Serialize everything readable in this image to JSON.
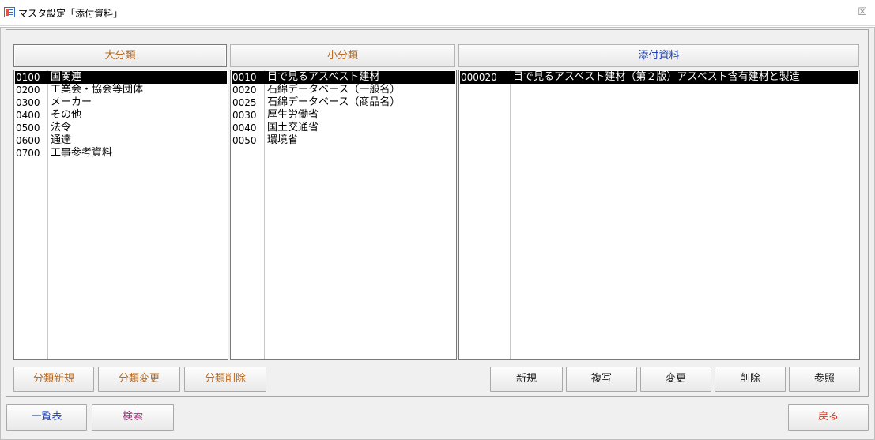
{
  "window": {
    "title": "マスタ設定「添付資料」",
    "close_glyph": "☒"
  },
  "headers": {
    "major": "大分類",
    "minor": "小分類",
    "attachment": "添付資料"
  },
  "major_list": [
    {
      "code": "0100",
      "name": "国関連",
      "selected": true
    },
    {
      "code": "0200",
      "name": "工業会・協会等団体"
    },
    {
      "code": "0300",
      "name": "メーカー"
    },
    {
      "code": "0400",
      "name": "その他"
    },
    {
      "code": "0500",
      "name": "法令"
    },
    {
      "code": "0600",
      "name": "通達"
    },
    {
      "code": "0700",
      "name": "工事参考資料"
    }
  ],
  "minor_list": [
    {
      "code": "0010",
      "name": "目で見るアスベスト建材",
      "selected": true
    },
    {
      "code": "0020",
      "name": "石綿データベース（一般名）"
    },
    {
      "code": "0025",
      "name": "石綿データベース（商品名）"
    },
    {
      "code": "0030",
      "name": "厚生労働省"
    },
    {
      "code": "0040",
      "name": "国土交通省"
    },
    {
      "code": "0050",
      "name": "環境省"
    }
  ],
  "attachment_list": [
    {
      "code": "000020",
      "name": "目で見るアスベスト建材（第２版）アスベスト含有建材と製造",
      "selected": true
    }
  ],
  "category_buttons": {
    "new": "分類新規",
    "edit": "分類変更",
    "delete": "分類削除"
  },
  "attachment_buttons": {
    "new": "新規",
    "copy": "複写",
    "edit": "変更",
    "delete": "削除",
    "browse": "参照"
  },
  "bottom_buttons": {
    "list": "一覧表",
    "search": "検索",
    "back": "戻る"
  },
  "colors": {
    "orange": "#b86a22",
    "blue": "#1f3fb0",
    "magenta": "#a0307a",
    "red": "#d9301e",
    "selected_bg": "#000000"
  }
}
